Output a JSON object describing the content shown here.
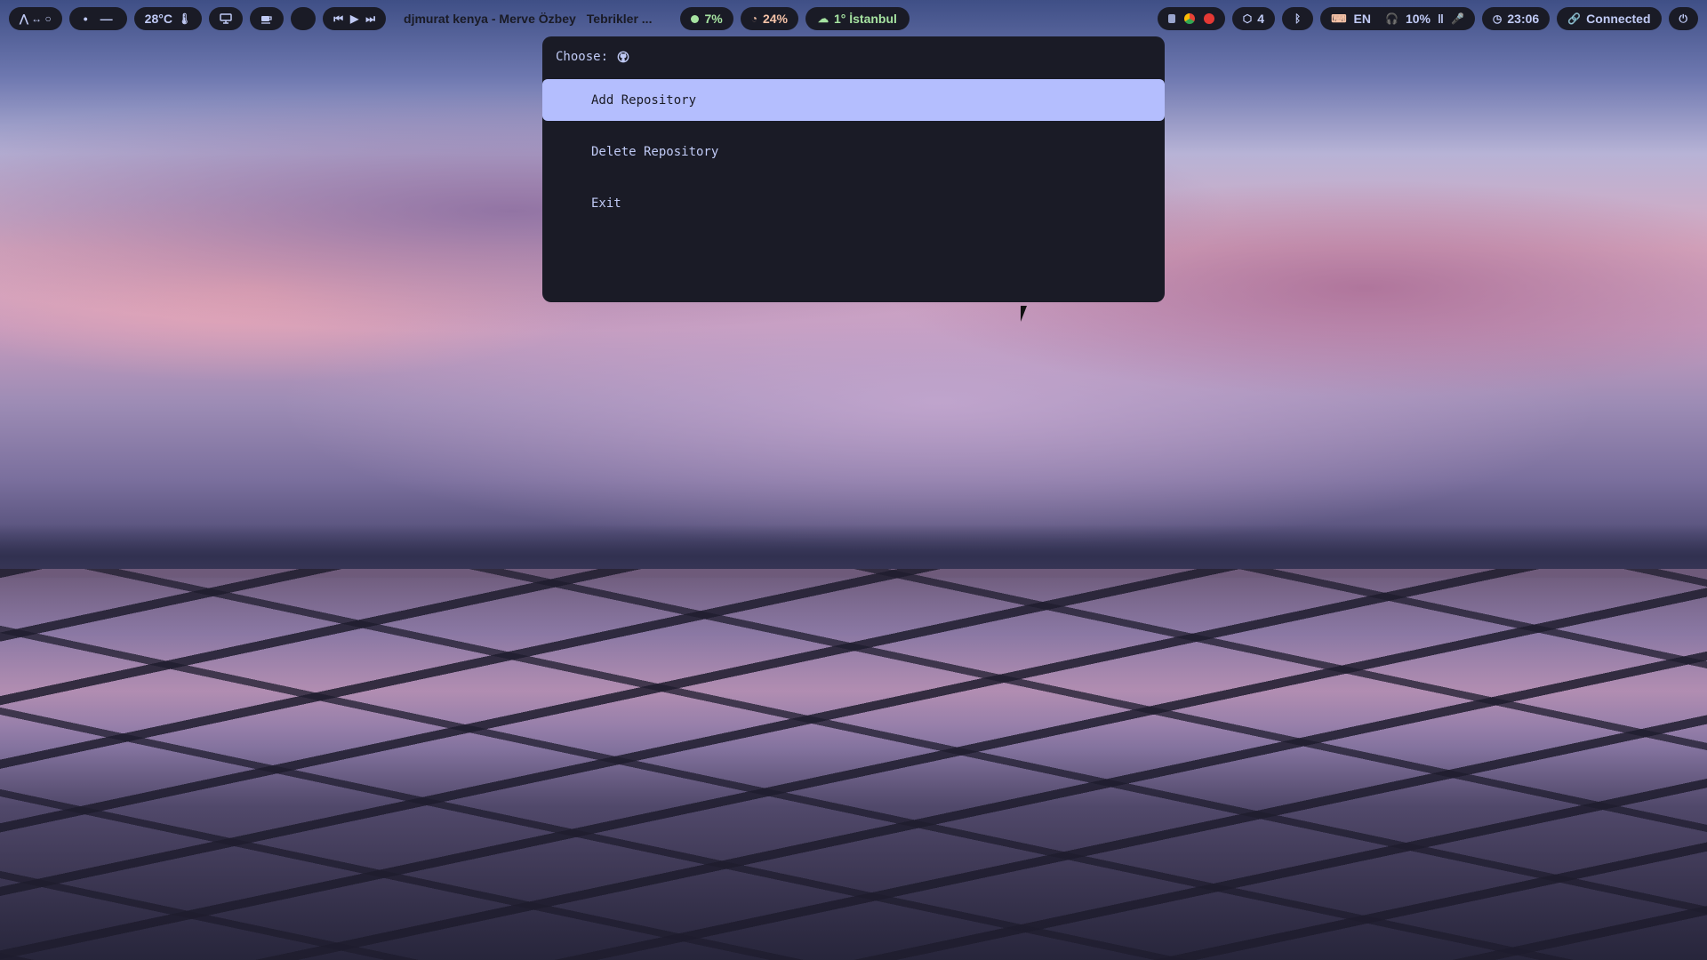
{
  "topbar": {
    "left": {
      "distro_icons": "⋀ ↔ ○",
      "workspace_dot": "•",
      "workspace_dash": "—",
      "temperature": "28°C",
      "thermo_icon": "🌡",
      "screen_icon": "monitor-icon",
      "coffee_icon": "coffee-icon",
      "media_prev": "⏮",
      "media_play": "▶",
      "media_next": "⏭"
    },
    "window_title": "djmurat kenya - Merve Özbey",
    "window_title_2": "Tebrikler ...",
    "cpu": "7%",
    "memory": "24%",
    "weather": "1° İstanbul",
    "right": {
      "workspaces_count": "4",
      "language": "EN",
      "volume": "10%",
      "pause_glyph": "‖",
      "clock": "23:06",
      "network": "Connected"
    },
    "colors": {
      "pill_bg": "#1a1b26",
      "text": "#c0caf5",
      "accent_green": "#a6e3a1",
      "accent_orange": "#f5c2a7"
    }
  },
  "launcher": {
    "prompt_label": "Choose:",
    "prompt_icon": "github-icon",
    "input_value": "",
    "items": [
      {
        "label": "Add Repository",
        "selected": true
      },
      {
        "label": "Delete Repository",
        "selected": false
      },
      {
        "label": "Exit",
        "selected": false
      }
    ],
    "colors": {
      "background": "#1a1b26",
      "selected_bg": "#b4befe",
      "selected_text": "#1a1b26",
      "text": "#c0caf5"
    }
  }
}
